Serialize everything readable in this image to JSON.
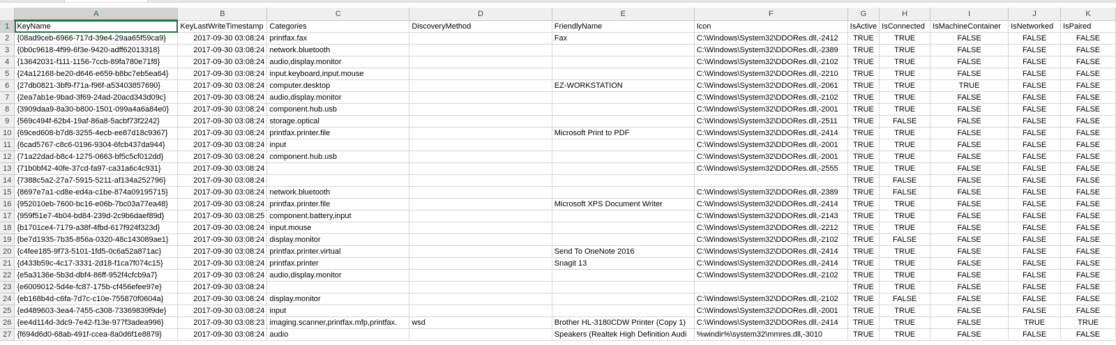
{
  "columns": [
    "A",
    "B",
    "C",
    "D",
    "E",
    "F",
    "G",
    "H",
    "I",
    "J",
    "K"
  ],
  "header_row": [
    "KeyName",
    "KeyLastWriteTimestamp",
    "Categories",
    "DiscoveryMethod",
    "FriendlyName",
    "Icon",
    "IsActive",
    "IsConnected",
    "IsMachineContainer",
    "IsNetworked",
    "IsPaired"
  ],
  "rows": [
    [
      "{08ad9ceb-6966-717d-39e4-29aa65f59ca9}",
      "2017-09-30 03:08:24",
      "printfax.fax",
      "",
      "Fax",
      "C:\\Windows\\System32\\DDORes.dll,-2412",
      "TRUE",
      "TRUE",
      "FALSE",
      "FALSE",
      "FALSE"
    ],
    [
      "{0b0c9618-4f99-6f3e-9420-adff62013318}",
      "2017-09-30 03:08:24",
      "network.bluetooth",
      "",
      "",
      "C:\\Windows\\System32\\DDORes.dll,-2389",
      "TRUE",
      "TRUE",
      "FALSE",
      "FALSE",
      "FALSE"
    ],
    [
      "{13642031-f111-1156-7ccb-89fa780e71f8}",
      "2017-09-30 03:08:24",
      "audio,display.monitor",
      "",
      "",
      "C:\\Windows\\System32\\DDORes.dll,-2102",
      "TRUE",
      "TRUE",
      "FALSE",
      "FALSE",
      "FALSE"
    ],
    [
      "{24a12168-be20-d646-e659-b8bc7eb5ea64}",
      "2017-09-30 03:08:24",
      "input.keyboard,input.mouse",
      "",
      "",
      "C:\\Windows\\System32\\DDORes.dll,-2210",
      "TRUE",
      "TRUE",
      "FALSE",
      "FALSE",
      "FALSE"
    ],
    [
      "{27db0821-3bf9-f71a-f96f-a53403857690}",
      "2017-09-30 03:08:24",
      "computer.desktop",
      "",
      "EZ-WORKSTATION",
      "C:\\Windows\\System32\\DDORes.dll,-2061",
      "TRUE",
      "TRUE",
      "TRUE",
      "FALSE",
      "FALSE"
    ],
    [
      "{2ea7ab1e-9bad-3f69-24ad-20acd343d09c}",
      "2017-09-30 03:08:24",
      "audio,display.monitor",
      "",
      "",
      "C:\\Windows\\System32\\DDORes.dll,-2102",
      "TRUE",
      "TRUE",
      "FALSE",
      "FALSE",
      "FALSE"
    ],
    [
      "{3909daa9-8a30-b800-1501-099a4a6a84e0}",
      "2017-09-30 03:08:24",
      "component.hub.usb",
      "",
      "",
      "C:\\Windows\\System32\\DDORes.dll,-2001",
      "TRUE",
      "TRUE",
      "FALSE",
      "FALSE",
      "FALSE"
    ],
    [
      "{569c494f-62b4-19af-86a8-5acbf73f2242}",
      "2017-09-30 03:08:24",
      "storage.optical",
      "",
      "",
      "C:\\Windows\\System32\\DDORes.dll,-2511",
      "TRUE",
      "FALSE",
      "FALSE",
      "FALSE",
      "FALSE"
    ],
    [
      "{69ced608-b7d8-3255-4ecb-ee87d18c9367}",
      "2017-09-30 03:08:24",
      "printfax.printer.file",
      "",
      "Microsoft Print to PDF",
      "C:\\Windows\\System32\\DDORes.dll,-2414",
      "TRUE",
      "TRUE",
      "FALSE",
      "FALSE",
      "FALSE"
    ],
    [
      "{6cad5767-c8c6-0196-9304-6fcb437da944}",
      "2017-09-30 03:08:24",
      "input",
      "",
      "",
      "C:\\Windows\\System32\\DDORes.dll,-2001",
      "TRUE",
      "TRUE",
      "FALSE",
      "FALSE",
      "FALSE"
    ],
    [
      "{71a22dad-b8c4-1275-0663-bf5c5cf012dd}",
      "2017-09-30 03:08:24",
      "component.hub.usb",
      "",
      "",
      "C:\\Windows\\System32\\DDORes.dll,-2001",
      "TRUE",
      "TRUE",
      "FALSE",
      "FALSE",
      "FALSE"
    ],
    [
      "{71b0bf42-40fe-37cd-fa97-ca31a6c4c931}",
      "2017-09-30 03:08:24",
      "",
      "",
      "",
      "C:\\Windows\\System32\\DDORes.dll,-2555",
      "TRUE",
      "TRUE",
      "FALSE",
      "FALSE",
      "FALSE"
    ],
    [
      "{7388c5a2-27a7-5915-5211-af134a252796}",
      "2017-09-30 03:08:24",
      "",
      "",
      "",
      "",
      "TRUE",
      "FALSE",
      "FALSE",
      "FALSE",
      "FALSE"
    ],
    [
      "{8697e7a1-cd8e-ed4a-c1be-874a09195715}",
      "2017-09-30 03:08:24",
      "network.bluetooth",
      "",
      "",
      "C:\\Windows\\System32\\DDORes.dll,-2389",
      "TRUE",
      "FALSE",
      "FALSE",
      "FALSE",
      "FALSE"
    ],
    [
      "{952010eb-7600-bc16-e06b-7bc03a77ea48}",
      "2017-09-30 03:08:24",
      "printfax.printer.file",
      "",
      "Microsoft XPS Document Writer",
      "C:\\Windows\\System32\\DDORes.dll,-2414",
      "TRUE",
      "TRUE",
      "FALSE",
      "FALSE",
      "FALSE"
    ],
    [
      "{959f51e7-4b04-bd84-239d-2c9b6daef89d}",
      "2017-09-30 03:08:25",
      "component.battery,input",
      "",
      "",
      "C:\\Windows\\System32\\DDORes.dll,-2143",
      "TRUE",
      "TRUE",
      "FALSE",
      "FALSE",
      "FALSE"
    ],
    [
      "{b1701ce4-7179-a38f-4fbd-617f924f323d}",
      "2017-09-30 03:08:24",
      "input.mouse",
      "",
      "",
      "C:\\Windows\\System32\\DDORes.dll,-2212",
      "TRUE",
      "TRUE",
      "FALSE",
      "FALSE",
      "FALSE"
    ],
    [
      "{be7d1935-7b35-856a-0320-48c143089ae1}",
      "2017-09-30 03:08:24",
      "display.monitor",
      "",
      "",
      "C:\\Windows\\System32\\DDORes.dll,-2102",
      "TRUE",
      "FALSE",
      "FALSE",
      "FALSE",
      "FALSE"
    ],
    [
      "{c4fee185-9f73-5101-1fd5-0c6a52a871ac}",
      "2017-09-30 03:08:24",
      "printfax.printer.virtual",
      "",
      "Send To OneNote 2016",
      "C:\\Windows\\System32\\DDORes.dll,-2414",
      "TRUE",
      "TRUE",
      "FALSE",
      "FALSE",
      "FALSE"
    ],
    [
      "{d433b59c-4c17-3331-2d18-f1ca7f074c15}",
      "2017-09-30 03:08:24",
      "printfax.printer",
      "",
      "Snagit 13",
      "C:\\Windows\\System32\\DDORes.dll,-2414",
      "TRUE",
      "TRUE",
      "FALSE",
      "FALSE",
      "FALSE"
    ],
    [
      "{e5a3136e-5b3d-dbf4-86ff-952f4cfcb9a7}",
      "2017-09-30 03:08:24",
      "audio,display.monitor",
      "",
      "",
      "C:\\Windows\\System32\\DDORes.dll,-2102",
      "TRUE",
      "TRUE",
      "FALSE",
      "FALSE",
      "FALSE"
    ],
    [
      "{e6009012-5d4e-fc87-175b-cf456efee97e}",
      "2017-09-30 03:08:24",
      "",
      "",
      "",
      "",
      "TRUE",
      "TRUE",
      "FALSE",
      "FALSE",
      "FALSE"
    ],
    [
      "{eb168b4d-c6fa-7d7c-c10e-755870f0604a}",
      "2017-09-30 03:08:24",
      "display.monitor",
      "",
      "",
      "C:\\Windows\\System32\\DDORes.dll,-2102",
      "TRUE",
      "FALSE",
      "FALSE",
      "FALSE",
      "FALSE"
    ],
    [
      "{ed489603-3ea4-7455-c308-73369839f9de}",
      "2017-09-30 03:08:24",
      "input",
      "",
      "",
      "C:\\Windows\\System32\\DDORes.dll,-2001",
      "TRUE",
      "TRUE",
      "FALSE",
      "FALSE",
      "FALSE"
    ],
    [
      "{ee4d114d-3dc9-7e42-f13e-977f3adea996}",
      "2017-09-30 03:08:23",
      "imaging.scanner,printfax.mfp,printfax.",
      "wsd",
      "Brother HL-3180CDW Printer (Copy 1)",
      "C:\\Windows\\System32\\DDORes.dll,-2414",
      "TRUE",
      "TRUE",
      "FALSE",
      "TRUE",
      "TRUE"
    ],
    [
      "{f694d6d0-68ab-491f-ccea-8a0d6f1e8879}",
      "2017-09-30 03:08:24",
      "audio",
      "",
      "Speakers (Realtek High Definition Audi",
      "%windir%\\system32\\mmres.dll,-3010",
      "TRUE",
      "TRUE",
      "FALSE",
      "FALSE",
      "FALSE"
    ]
  ]
}
